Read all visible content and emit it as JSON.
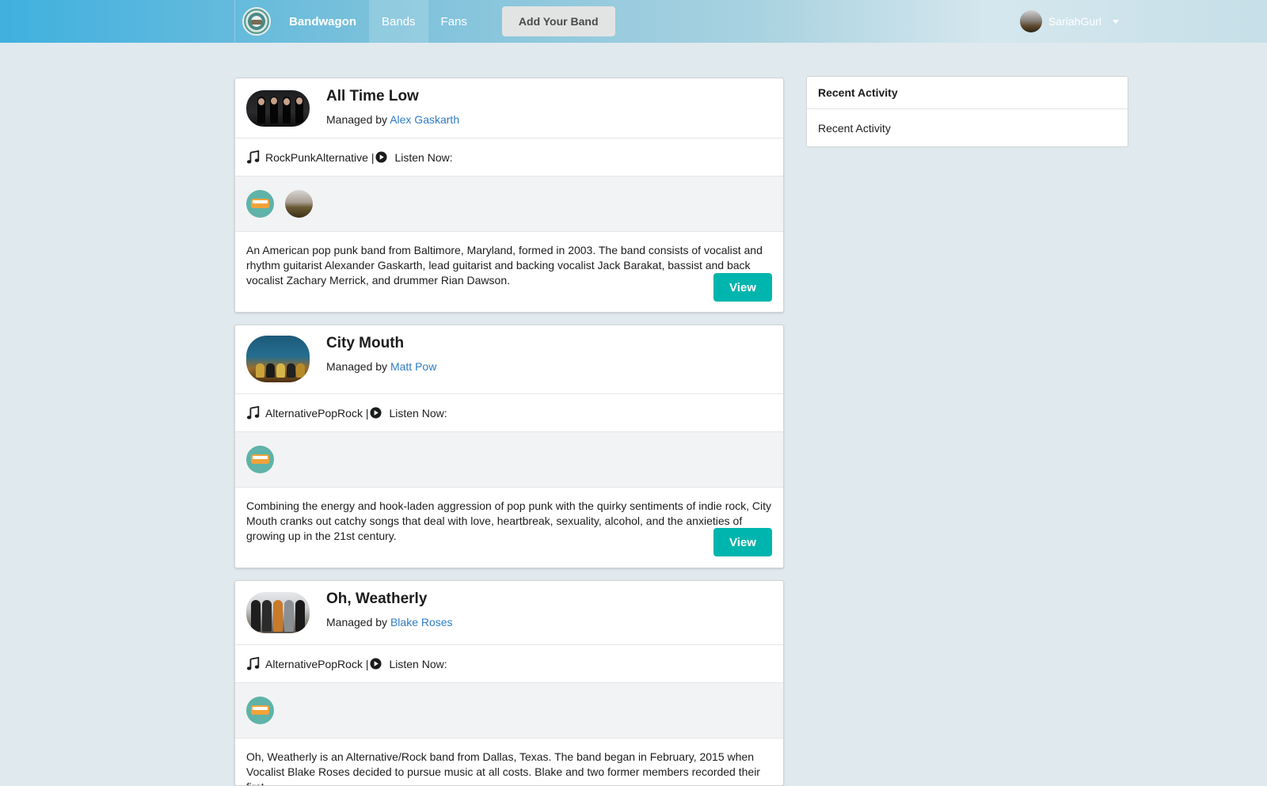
{
  "nav": {
    "brand": "Bandwagon",
    "items": [
      {
        "label": "Bands",
        "active": true
      },
      {
        "label": "Fans",
        "active": false
      }
    ],
    "add_band_label": "Add Your Band",
    "user_name": "SariahGurl"
  },
  "managed_prefix": "Managed by",
  "listen_now_label": "Listen Now:",
  "view_label": "View",
  "bands": [
    {
      "name": "All Time Low",
      "manager": "Alex Gaskarth",
      "genres": "RockPunkAlternative |",
      "fan_avatars": [
        "van",
        "sunset"
      ],
      "description": "An American pop punk band from Baltimore, Maryland, formed in 2003. The band consists of vocalist and rhythm guitarist Alexander Gaskarth, lead guitarist and backing vocalist Jack Barakat, bassist and back vocalist Zachary Merrick, and drummer Rian Dawson."
    },
    {
      "name": "City Mouth",
      "manager": "Matt Pow",
      "genres": "AlternativePopRock |",
      "fan_avatars": [
        "van"
      ],
      "description": "Combining the energy and hook-laden aggression of pop punk with the quirky sentiments of indie rock, City Mouth cranks out catchy songs that deal with love, heartbreak, sexuality, alcohol, and the anxieties of growing up in the 21st century."
    },
    {
      "name": "Oh, Weatherly",
      "manager": "Blake Roses",
      "genres": "AlternativePopRock |",
      "fan_avatars": [
        "van"
      ],
      "description": "Oh, Weatherly is an Alternative/Rock band from Dallas, Texas. The band began in February, 2015 when Vocalist Blake Roses decided to pursue music at all costs. Blake and two former members recorded their first"
    }
  ],
  "sidebar": {
    "title": "Recent Activity",
    "body": "Recent Activity"
  },
  "colors": {
    "accent": "#00b5ad",
    "link": "#2f7cc4",
    "page_bg": "#dfe9ee"
  }
}
